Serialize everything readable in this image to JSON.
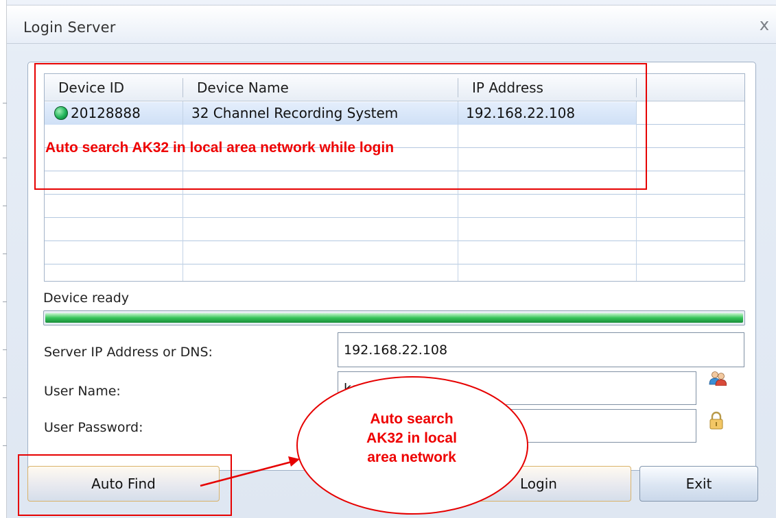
{
  "window": {
    "title": "Login Server",
    "close_glyph": "x"
  },
  "table": {
    "columns": [
      "Device ID",
      "Device Name",
      "IP Address"
    ],
    "rows": [
      {
        "status_icon": "green-status-dot",
        "device_id": "20128888",
        "device_name": "32 Channel Recording System",
        "ip": "192.168.22.108"
      }
    ]
  },
  "annotations": {
    "table_note": "Auto search AK32 in local area network while login",
    "bubble_line1": "Auto search",
    "bubble_line2": "AK32 in local",
    "bubble_line3": "area network",
    "color": "#e60000"
  },
  "status": {
    "text": "Device ready",
    "progress": 1.0
  },
  "form": {
    "server_label": "Server IP Address or DNS:",
    "server_value": "192.168.22.108",
    "user_label": "User Name:",
    "user_value": "ken",
    "password_label": "User Password:",
    "password_value": ""
  },
  "buttons": {
    "auto_find": "Auto Find",
    "login": "Login",
    "exit": "Exit"
  },
  "icons": {
    "users": "users-icon",
    "lock": "lock-icon"
  }
}
